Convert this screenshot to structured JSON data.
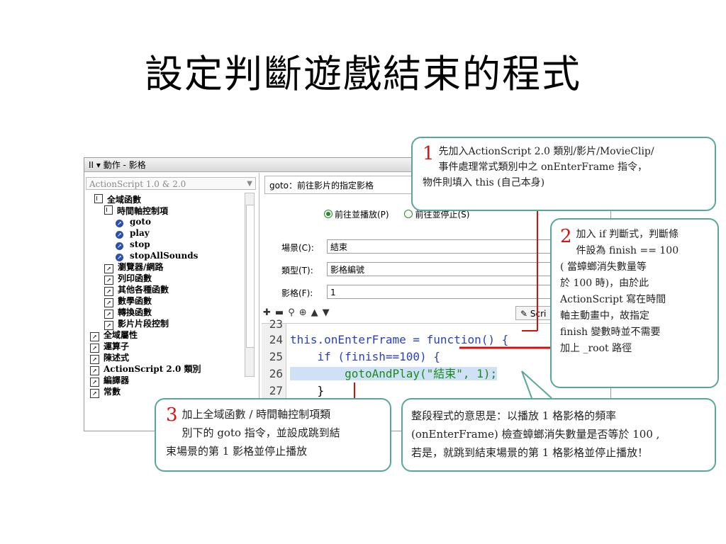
{
  "title": "設定判斷遊戲結束的程式",
  "panel": {
    "header": "II ▾ 動作 - 影格",
    "version_select": "ActionScript 1.0 & 2.0",
    "tree": [
      {
        "label": "全域函數",
        "icon": "book-icon"
      },
      {
        "label": "時間軸控制項",
        "icon": "book-icon"
      },
      {
        "label": "goto",
        "icon": "action-circle-icon"
      },
      {
        "label": "play",
        "icon": "action-circle-icon"
      },
      {
        "label": "stop",
        "icon": "action-circle-icon"
      },
      {
        "label": "stopAllSounds",
        "icon": "action-circle-icon"
      },
      {
        "label": "瀏覽器/網路",
        "icon": "category-icon"
      },
      {
        "label": "列印函數",
        "icon": "category-icon"
      },
      {
        "label": "其他各種函數",
        "icon": "category-icon"
      },
      {
        "label": "數學函數",
        "icon": "category-icon"
      },
      {
        "label": "轉換函數",
        "icon": "category-icon"
      },
      {
        "label": "影片片段控制",
        "icon": "category-icon"
      },
      {
        "label": "全域屬性",
        "icon": "category-icon"
      },
      {
        "label": "運算子",
        "icon": "category-icon"
      },
      {
        "label": "陳述式",
        "icon": "category-icon"
      },
      {
        "label": "ActionScript 2.0 類別",
        "icon": "category-icon"
      },
      {
        "label": "編譯器",
        "icon": "category-icon"
      },
      {
        "label": "常數",
        "icon": "category-icon"
      }
    ],
    "goto_description": "goto：前往影片的指定影格",
    "radio_play": "前往並播放(P)",
    "radio_stop": "前往並停止(S)",
    "scene_label": "場景(C):",
    "scene_value": "結束",
    "type_label": "類型(T):",
    "type_value": "影格編號",
    "frame_label": "影格(F):",
    "frame_value": "1",
    "script_button": "Scri",
    "code": [
      {
        "num": "23",
        "text": ""
      },
      {
        "num": "24",
        "text": "this.onEnterFrame = function() {"
      },
      {
        "num": "25",
        "text": "    if (finish==100) {"
      },
      {
        "num": "26",
        "text": "        gotoAndPlay(\"結束\", 1);"
      },
      {
        "num": "27",
        "text": "    }"
      }
    ]
  },
  "callouts": {
    "c1_num": "1",
    "c1_line1": "先加入ActionScript 2.0 類別/影片/MovieClip/",
    "c1_line2": "事件處理常式類別中之 onEnterFrame  指令，",
    "c1_line3": "物件則填入 this (自己本身)",
    "c2_num": "2",
    "c2_line1": "加入 if 判斷式，判斷條",
    "c2_line2": "件設為 finish == 100",
    "c2_line3": "( 當蟑螂消失數量等",
    "c2_line4": "於 100 時)，由於此",
    "c2_line5": "ActionScript 寫在時間",
    "c2_line6": "軸主動畫中，故指定",
    "c2_line7": "finish 變數時並不需要",
    "c2_line8": "加上 _root 路徑",
    "c3_num": "3",
    "c3_line1": "加上全域函數 / 時間軸控制項類",
    "c3_line2": "別下的 goto 指令，並設成跳到結",
    "c3_line3": "束場景的第 1 影格並停止播放",
    "c4_line1": "整段程式的意思是：以播放  1   格影格的頻率",
    "c4_line2": "(onEnterFrame) 檢查蟑螂消失數量是否等於 100 ,",
    "c4_line3": "若是，就跳到結束場景的第 1 格影格並停止播放！"
  },
  "colors": {
    "accent_teal": "#57a89a",
    "marker_red": "#d11111",
    "code_blue": "#2a3fbf",
    "code_green": "#1a8a1a"
  }
}
